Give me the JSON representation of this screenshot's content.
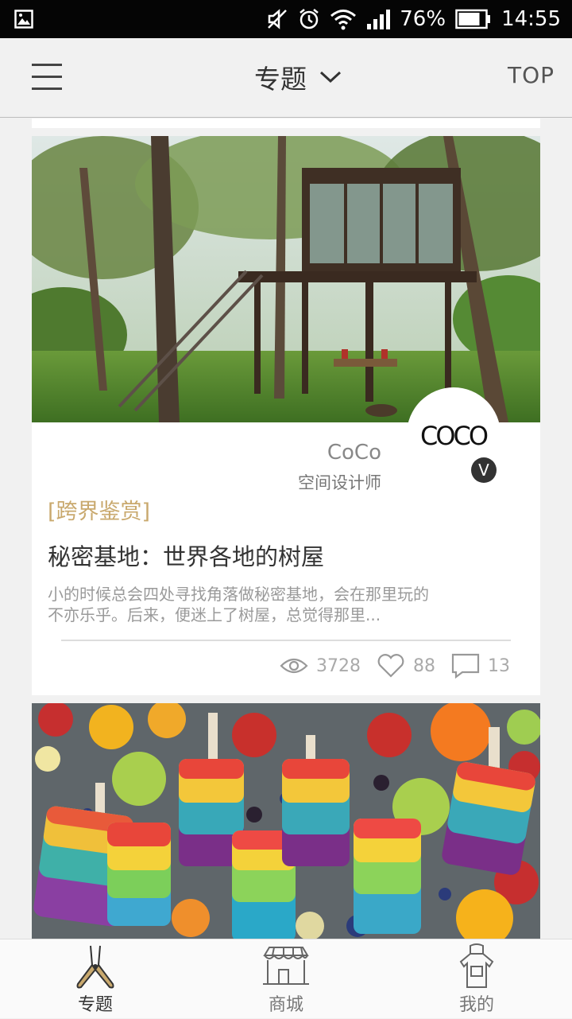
{
  "status_bar": {
    "battery": "76%",
    "time": "14:55",
    "icons": [
      "gallery-icon",
      "mute-icon",
      "alarm-icon",
      "wifi-icon",
      "signal-icon",
      "battery-icon"
    ]
  },
  "header": {
    "menu_icon": "hamburger-icon",
    "title": "专题",
    "dropdown_icon": "chevron-down-icon",
    "top_label": "TOP"
  },
  "feed": {
    "card1": {
      "image_desc_icon": "treehouse-photo",
      "author": {
        "logo": "COCO",
        "name": "CoCo",
        "role": "空间设计师",
        "badge": "V"
      },
      "tag": "[跨界鉴赏]",
      "title": "秘密基地：世界各地的树屋",
      "summary_line1": "小的时候总会四处寻找角落做秘密基地，会在那里玩的",
      "summary_line2": "不亦乐乎。后来，便迷上了树屋，总觉得那里...",
      "stats": {
        "views": "3728",
        "likes": "88",
        "comments": "13"
      }
    },
    "card2": {
      "image_desc_icon": "popsicles-photo"
    }
  },
  "tabbar": {
    "tabs": [
      {
        "label": "专题",
        "icon": "scissors-icon",
        "active": true
      },
      {
        "label": "商城",
        "icon": "storefront-icon",
        "active": false
      },
      {
        "label": "我的",
        "icon": "apron-icon",
        "active": false
      }
    ]
  },
  "colors": {
    "accent_gold": "#c9a96e",
    "status_bar_bg": "#050505",
    "page_bg": "#f1f1f1"
  }
}
